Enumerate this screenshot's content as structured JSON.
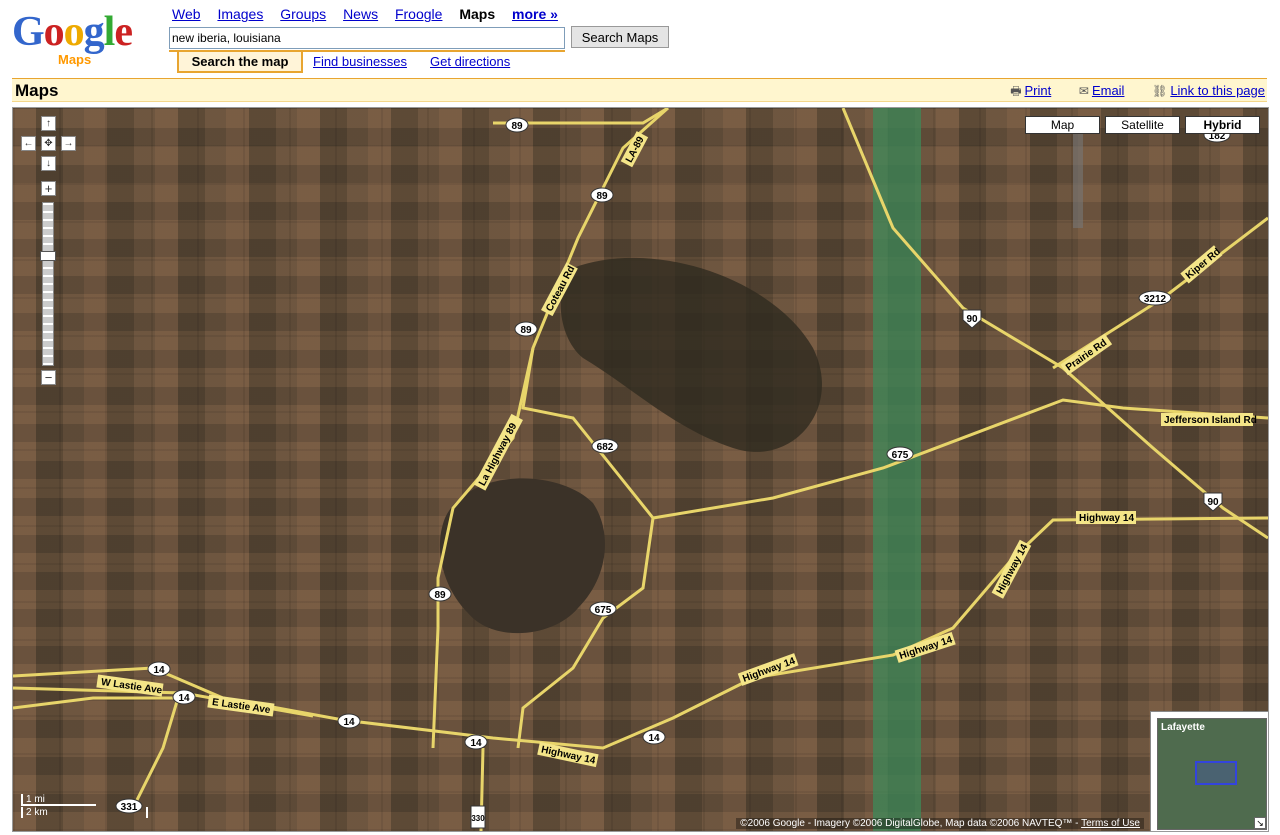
{
  "header": {
    "logo_text": "Google",
    "logo_sub": "Maps",
    "nav": {
      "web": "Web",
      "images": "Images",
      "groups": "Groups",
      "news": "News",
      "froogle": "Froogle",
      "maps": "Maps",
      "more": "more »"
    },
    "search_value": "new iberia, louisiana",
    "search_button": "Search Maps",
    "tabs": {
      "search_map": "Search the map",
      "find_businesses": "Find businesses",
      "get_directions": "Get directions"
    }
  },
  "titlebar": {
    "title": "Maps",
    "print": "Print",
    "email": "Email",
    "link": "Link to this page"
  },
  "map": {
    "types": {
      "map": "Map",
      "satellite": "Satellite",
      "hybrid": "Hybrid"
    },
    "selected_type": "Hybrid",
    "shields": [
      "89",
      "89",
      "89",
      "89",
      "682",
      "675",
      "675",
      "90",
      "90",
      "3212",
      "182",
      "14",
      "14",
      "14",
      "14",
      "14",
      "331",
      "330"
    ],
    "roads": {
      "w_lastie": "W Lastie Ave",
      "e_lastie": "E Lastie Ave",
      "highway_14": "Highway 14",
      "la_hwy_89": "La Highway 89",
      "la_89": "LA-89",
      "coteau": "Coteau Rd",
      "prairie": "Prairie Rd",
      "kiper": "Kiper Rd",
      "jefferson": "Jefferson Island Rd"
    },
    "scale": {
      "mi": "1 mi",
      "km": "2 km"
    },
    "copyright": "©2006 Google - Imagery ©2006 DigitalGlobe, Map data ©2006 NAVTEQ™ - ",
    "terms": "Terms of Use",
    "overview_label": "Lafayette"
  }
}
